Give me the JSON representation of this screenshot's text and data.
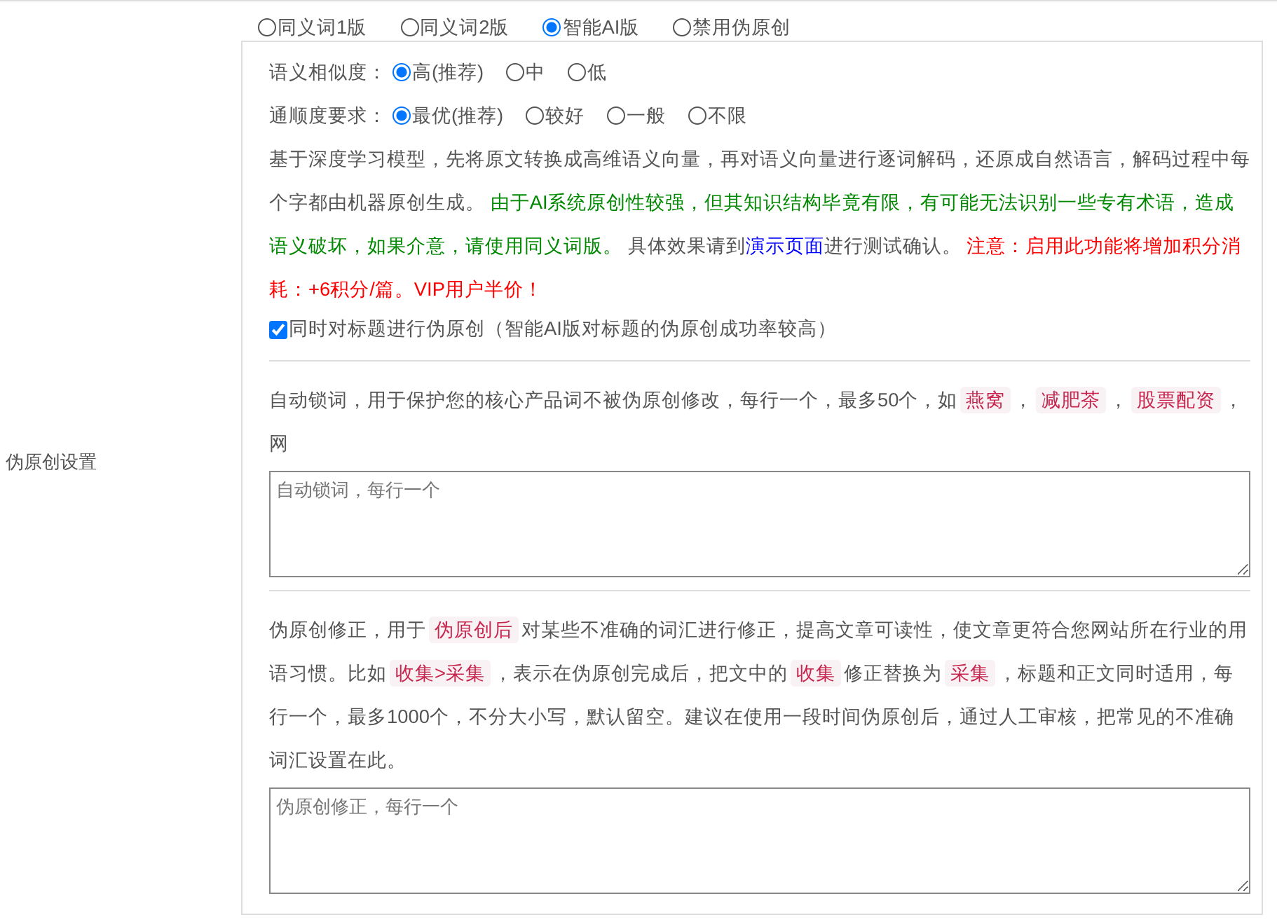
{
  "modes": [
    {
      "label": "同义词1版",
      "selected": false
    },
    {
      "label": "同义词2版",
      "selected": false
    },
    {
      "label": "智能AI版",
      "selected": true
    },
    {
      "label": "禁用伪原创",
      "selected": false
    }
  ],
  "section_label": "伪原创设置",
  "option_groups": [
    {
      "label": "语义相似度：",
      "options": [
        {
          "label": "高(推荐)",
          "selected": true
        },
        {
          "label": "中",
          "selected": false
        },
        {
          "label": "低",
          "selected": false
        }
      ]
    },
    {
      "label": "通顺度要求：",
      "options": [
        {
          "label": "最优(推荐)",
          "selected": true
        },
        {
          "label": "较好",
          "selected": false
        },
        {
          "label": "一般",
          "selected": false
        },
        {
          "label": "不限",
          "selected": false
        }
      ]
    }
  ],
  "description": [
    {
      "kind": "plain",
      "text": "基于深度学习模型，先将原文转换成高维语义向量，再对语义向量进行逐词解码，还原成自然语言，解码过程中每个字都由机器原创生成。 "
    },
    {
      "kind": "green",
      "text": "由于AI系统原创性较强，但其知识结构毕竟有限，有可能无法识别一些专有术语，造成语义破坏，如果介意，请使用同义词版。"
    },
    {
      "kind": "plain",
      "text": " 具体效果请到"
    },
    {
      "kind": "link",
      "text": "演示页面"
    },
    {
      "kind": "plain",
      "text": "进行测试确认。 "
    },
    {
      "kind": "red",
      "text": "注意：启用此功能将增加积分消耗：+6积分/篇。VIP用户半价！"
    }
  ],
  "title_checkbox": {
    "label": "同时对标题进行伪原创（智能AI版对标题的伪原创成功率较高）",
    "checked": true
  },
  "lock_words": {
    "text": [
      {
        "kind": "plain",
        "text": "自动锁词，用于保护您的核心产品词不被伪原创修改，每行一个，最多50个，如"
      },
      {
        "kind": "tag",
        "text": "燕窝"
      },
      {
        "kind": "plain",
        "text": "，"
      },
      {
        "kind": "tag",
        "text": "减肥茶"
      },
      {
        "kind": "plain",
        "text": "，"
      },
      {
        "kind": "tag",
        "text": "股票配资"
      },
      {
        "kind": "plain",
        "text": "，网"
      }
    ],
    "placeholder": "自动锁词，每行一个"
  },
  "correction": {
    "text": [
      {
        "kind": "plain",
        "text": "伪原创修正，用于"
      },
      {
        "kind": "tag",
        "text": "伪原创后"
      },
      {
        "kind": "plain",
        "text": "对某些不准确的词汇进行修正，提高文章可读性，使文章更符合您网站所在行业的用语习惯。比如"
      },
      {
        "kind": "tag",
        "text": "收集>采集"
      },
      {
        "kind": "plain",
        "text": "，表示在伪原创完成后，把文中的"
      },
      {
        "kind": "tag",
        "text": "收集"
      },
      {
        "kind": "plain",
        "text": "修正替换为"
      },
      {
        "kind": "tag",
        "text": "采集"
      },
      {
        "kind": "plain",
        "text": "，标题和正文同时适用，每行一个，最多1000个，不分大小写，默认留空。建议在使用一段时间伪原创后，通过人工审核，把常见的不准确词汇设置在此。"
      }
    ],
    "placeholder": "伪原创修正，每行一个"
  }
}
